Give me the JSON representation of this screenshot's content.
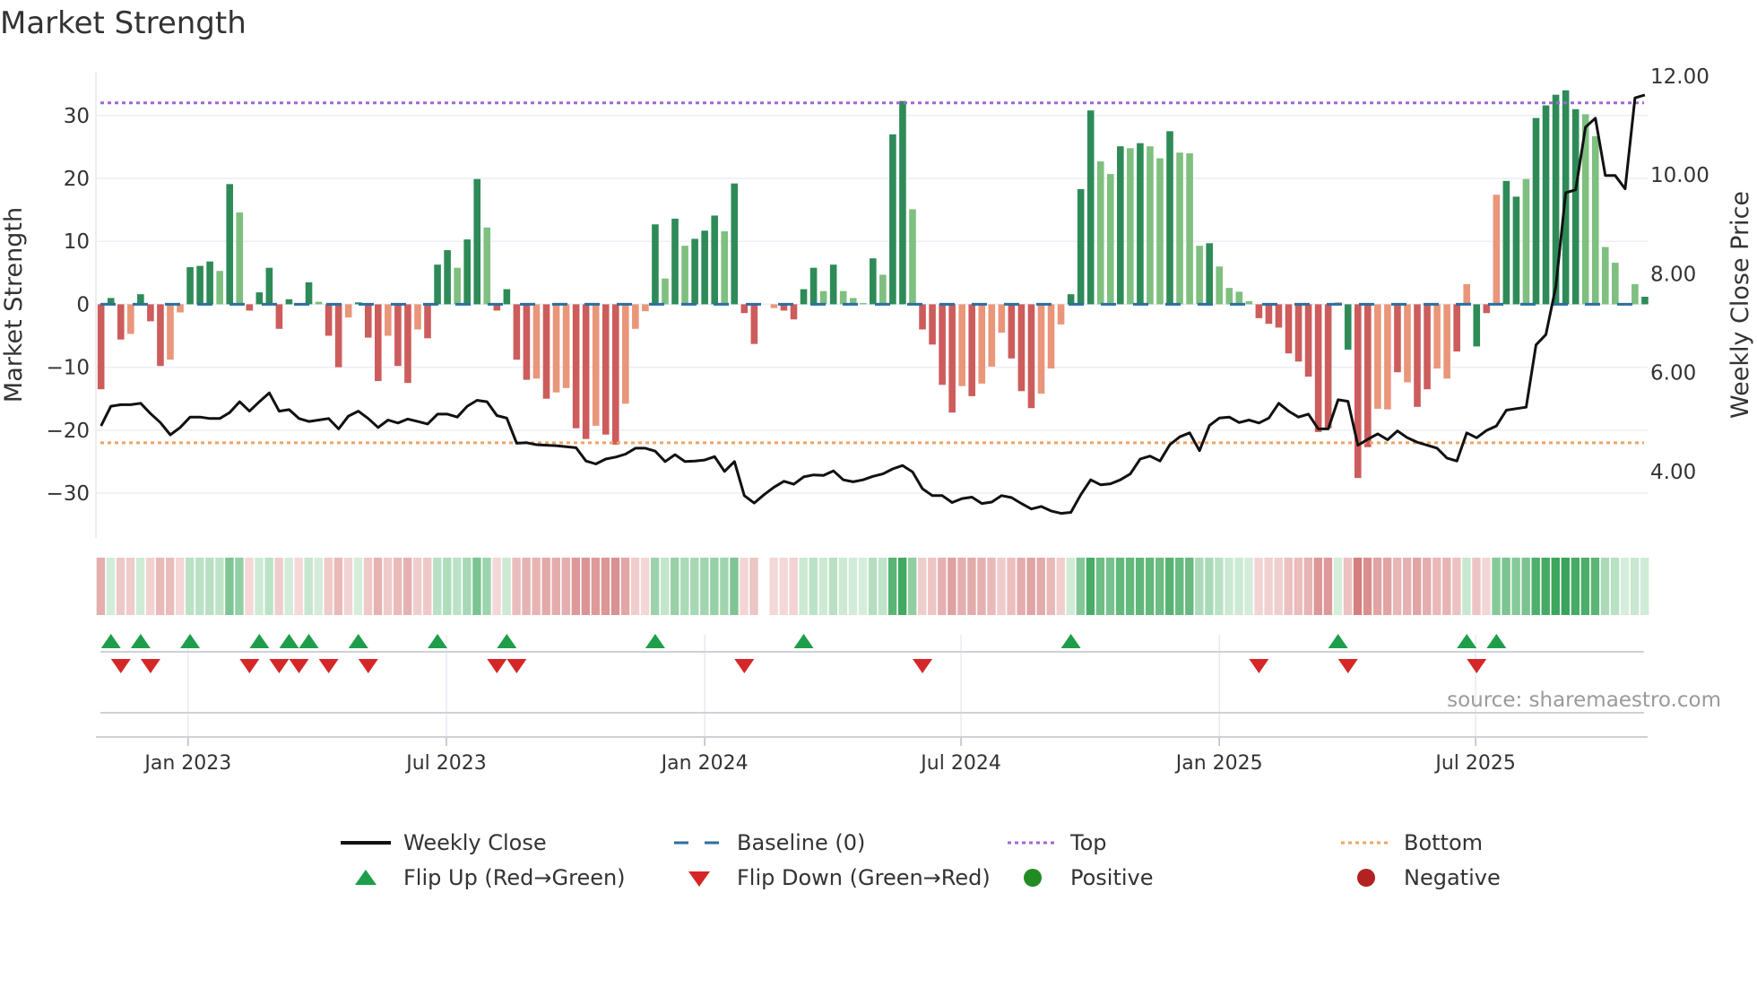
{
  "title": "Market Strength",
  "source": "source: sharemaestro.com",
  "chart_data": {
    "type": "bar",
    "title": "Market Strength",
    "ylabel": "Market Strength",
    "y2label": "Weekly Close Price",
    "ylim": [
      -37,
      36
    ],
    "y2lim": [
      2.6,
      12.3
    ],
    "yticks": [
      -30,
      -20,
      -10,
      0,
      10,
      20,
      30
    ],
    "ytick_labels": [
      "−30",
      "−20",
      "−10",
      "0",
      "10",
      "20",
      "30"
    ],
    "y2ticks": [
      4,
      6,
      8,
      10,
      12
    ],
    "y2tick_labels": [
      "4.00",
      "6.00",
      "8.00",
      "10.00",
      "12.00"
    ],
    "xticks_week_index": [
      8.8,
      34.9,
      61.0,
      86.9,
      113.0,
      138.9
    ],
    "xtick_labels": [
      "Jan 2023",
      "Jul 2023",
      "Jan 2024",
      "Jul 2024",
      "Jan 2025",
      "Jul 2025"
    ],
    "top_level": 32,
    "bottom_level": -22,
    "baseline": 0,
    "strength": [
      -13.5,
      1,
      -5.6,
      -4.7,
      1.6,
      -2.7,
      -9.8,
      -8.8,
      -1.3,
      5.9,
      6.1,
      6.8,
      5.3,
      19.1,
      14.6,
      -1.0,
      1.9,
      5.8,
      -3.9,
      0.8,
      -0.2,
      3.5,
      0.4,
      -5,
      -10,
      -2.1,
      0.3,
      -5.3,
      -12.2,
      -5,
      -9.8,
      -12.5,
      -4,
      -5.4,
      6.3,
      8.6,
      5.8,
      10.3,
      19.9,
      12.2,
      -1,
      2.4,
      -8.8,
      -12,
      -11.8,
      -15,
      -14,
      -13.3,
      -19.7,
      -21.4,
      -19.3,
      -20.7,
      -22.3,
      -15.8,
      -3.9,
      -1.1,
      12.7,
      4.1,
      13.6,
      9.3,
      10.4,
      11.7,
      14.1,
      11.6,
      19.2,
      -1.4,
      -6.3,
      0,
      -0.6,
      -1.0,
      -2.4,
      2.4,
      5.8,
      2.1,
      6.3,
      2.1,
      1.0,
      0.2,
      7.3,
      4.7,
      27,
      32.3,
      15.1,
      -4,
      -6.4,
      -12.8,
      -17.2,
      -13,
      -14.6,
      -12.6,
      -9.9,
      -4.5,
      -8.6,
      -13.8,
      -16.5,
      -14.2,
      -10.2,
      -3.2,
      1.6,
      18.3,
      30.8,
      22.7,
      20.7,
      25.1,
      24.8,
      25.6,
      25.1,
      23.2,
      27.5,
      24.1,
      24.0,
      9.3,
      9.7,
      6.0,
      2.6,
      2.0,
      0.5,
      -2.2,
      -3.1,
      -3.7,
      -7.8,
      -9.1,
      -11.5,
      -20.3,
      -19.7,
      0.3,
      -7.2,
      -27.6,
      -22.7,
      -16.6,
      -16.7,
      -10.8,
      -12.4,
      -16.3,
      -13.5,
      -10.2,
      -11.8,
      -7.5,
      3.2,
      -6.7,
      -1.4,
      17.4,
      19.6,
      17.1,
      19.9,
      29.6,
      31.6,
      33.3,
      34,
      31,
      30.2,
      26.7,
      9.1,
      6.6,
      0.2,
      3.2,
      1.2
    ],
    "strength_shade": "RGRrGRRrrGGGgGgRGGRGRGgRRrGRRrRRrRGGgGGgRGRRrRrrRRrRRrrrGgGgGGGgGRRrrRRGGgGgggGgGGgRRRRrRrrrRRRrrrGGGggGgGggGgggGggggRRRRRRRRrGRRrrRrRRrrRrGRrGGgGGGGGggggggGg",
    "weekly_close": [
      4.92,
      5.32,
      5.35,
      5.35,
      5.38,
      5.17,
      4.99,
      4.74,
      4.89,
      5.1,
      5.1,
      5.07,
      5.07,
      5.19,
      5.41,
      5.22,
      5.41,
      5.59,
      5.22,
      5.25,
      5.07,
      5.01,
      5.04,
      5.07,
      4.86,
      5.12,
      5.22,
      5.07,
      4.89,
      5.04,
      4.98,
      5.06,
      5.01,
      4.96,
      5.16,
      5.16,
      5.1,
      5.32,
      5.44,
      5.41,
      5.13,
      5.08,
      4.57,
      4.58,
      4.54,
      4.53,
      4.52,
      4.5,
      4.48,
      4.21,
      4.15,
      4.25,
      4.29,
      4.35,
      4.47,
      4.47,
      4.41,
      4.2,
      4.34,
      4.2,
      4.21,
      4.23,
      4.3,
      4.0,
      4.2,
      3.51,
      3.36,
      3.53,
      3.68,
      3.8,
      3.74,
      3.89,
      3.93,
      3.92,
      4.01,
      3.83,
      3.79,
      3.83,
      3.9,
      3.95,
      4.05,
      4.12,
      3.99,
      3.65,
      3.51,
      3.51,
      3.37,
      3.45,
      3.48,
      3.35,
      3.38,
      3.51,
      3.47,
      3.35,
      3.24,
      3.29,
      3.2,
      3.15,
      3.17,
      3.53,
      3.83,
      3.73,
      3.75,
      3.83,
      3.95,
      4.25,
      4.31,
      4.21,
      4.54,
      4.7,
      4.78,
      4.42,
      4.93,
      5.08,
      5.1,
      4.99,
      5.04,
      4.98,
      5.08,
      5.38,
      5.22,
      5.1,
      5.16,
      4.86,
      4.86,
      5.45,
      5.42,
      4.53,
      4.65,
      4.76,
      4.64,
      4.82,
      4.68,
      4.59,
      4.53,
      4.47,
      4.27,
      4.21,
      4.78,
      4.68,
      4.83,
      4.92,
      5.24,
      5.27,
      5.3,
      6.56,
      6.77,
      7.74,
      9.64,
      9.7,
      10.97,
      11.15,
      9.99,
      9.99,
      9.72,
      11.56,
      11.62
    ],
    "flip_up_weeks": [
      1,
      4,
      9,
      16,
      19,
      21,
      26,
      34,
      41,
      56,
      71,
      98,
      125,
      138,
      141
    ],
    "flip_down_weeks": [
      2,
      5,
      15,
      18,
      20,
      23,
      27,
      40,
      42,
      65,
      83,
      117,
      126,
      139
    ],
    "legend": {
      "position": "bottom",
      "weekly_close": "Weekly Close",
      "baseline": "Baseline (0)",
      "top": "Top",
      "bottom": "Bottom",
      "flip_up": "Flip Up (Red→Green)",
      "flip_down": "Flip Down (Green→Red)",
      "positive": "Positive",
      "negative": "Negative"
    },
    "colors": {
      "strong_green": "#2e8b57",
      "soft_green": "#7fbf7f",
      "strong_red": "#cd5c5c",
      "soft_red": "#e9967a",
      "close_line": "#111111",
      "baseline": "#2a6fa0",
      "top": "#a066d8",
      "bottom": "#eea465",
      "flip_up": "#1e9e4a",
      "flip_down": "#d62728",
      "positive": "#228b22",
      "negative": "#b22222"
    }
  }
}
